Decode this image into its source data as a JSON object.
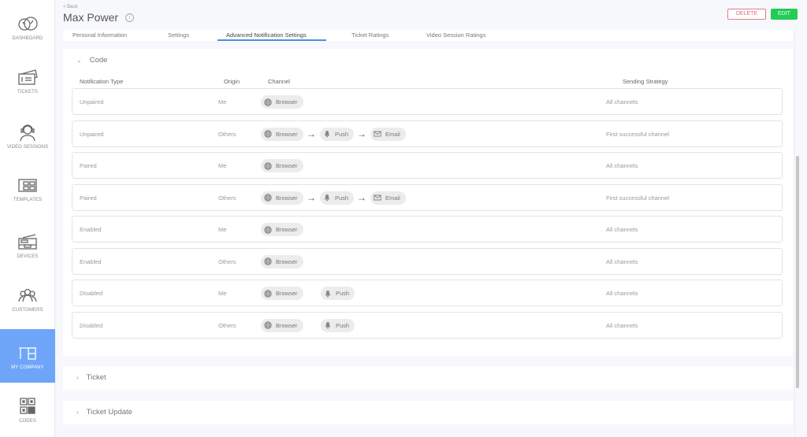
{
  "sidebar": {
    "items": [
      {
        "label": "Dashboard",
        "icon": "dashboard-icon",
        "active": false
      },
      {
        "label": "Tickets",
        "icon": "tickets-icon",
        "active": false
      },
      {
        "label": "Video Sessions",
        "icon": "headset-agent-icon",
        "active": false
      },
      {
        "label": "Templates",
        "icon": "templates-icon",
        "active": false
      },
      {
        "label": "Devices",
        "icon": "device-icon",
        "active": false
      },
      {
        "label": "Customers",
        "icon": "customers-icon",
        "active": false
      },
      {
        "label": "My Company",
        "icon": "desk-icon",
        "active": true
      },
      {
        "label": "Codes",
        "icon": "qr-code-icon",
        "active": false
      }
    ],
    "active_color": "#6ea5f8"
  },
  "header": {
    "back_label": "< Back",
    "title": "Max Power",
    "info_glyph": "i",
    "delete_label": "DELETE",
    "edit_label": "EDIT"
  },
  "tabs": [
    {
      "label": "Personal Information",
      "active": false
    },
    {
      "label": "Settings",
      "active": false
    },
    {
      "label": "Advanced Notification Settings",
      "active": true
    },
    {
      "label": "Ticket Ratings",
      "active": false
    },
    {
      "label": "Video Session Ratings",
      "active": false
    }
  ],
  "sections": {
    "code": {
      "title": "Code",
      "expanded": true,
      "columns": {
        "type": "Notification Type",
        "origin": "Origin",
        "channel": "Channel",
        "strategy": "Sending Strategy"
      },
      "rows": [
        {
          "type": "Unpaired",
          "origin": "Me",
          "channels": [
            "Browser"
          ],
          "strategy": "All channels"
        },
        {
          "type": "Unpaired",
          "origin": "Others",
          "channels": [
            "Browser",
            "Push",
            "Email"
          ],
          "strategy": "First successful channel"
        },
        {
          "type": "Paired",
          "origin": "Me",
          "channels": [
            "Browser"
          ],
          "strategy": "All channels"
        },
        {
          "type": "Paired",
          "origin": "Others",
          "channels": [
            "Browser",
            "Push",
            "Email"
          ],
          "strategy": "First successful channel"
        },
        {
          "type": "Enabled",
          "origin": "Me",
          "channels": [
            "Browser"
          ],
          "strategy": "All channels"
        },
        {
          "type": "Enabled",
          "origin": "Others",
          "channels": [
            "Browser"
          ],
          "strategy": "All channels"
        },
        {
          "type": "Disabled",
          "origin": "Me",
          "channels": [
            "Browser",
            "Push"
          ],
          "strategy": "All channels"
        },
        {
          "type": "Disabled",
          "origin": "Others",
          "channels": [
            "Browser",
            "Push"
          ],
          "strategy": "All channels"
        }
      ]
    },
    "ticket": {
      "title": "Ticket",
      "expanded": false
    },
    "ticket_update": {
      "title": "Ticket Update",
      "expanded": false
    }
  },
  "chips": {
    "browser": "Browser",
    "push": "Push",
    "email": "Email"
  }
}
